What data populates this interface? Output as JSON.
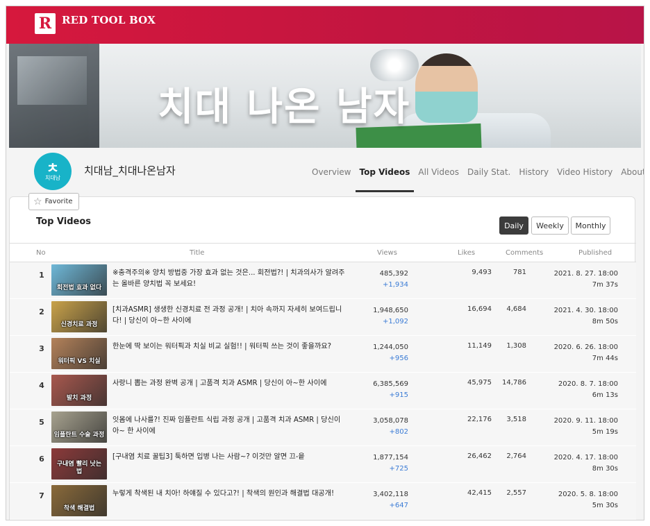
{
  "app": {
    "brand": "RED TOOL BOX",
    "logo_letter": "R"
  },
  "banner": {
    "title": "치대 나온 남자"
  },
  "channel": {
    "name": "치대남_치대나온남자",
    "avatar_glyph": "ㅊ",
    "avatar_sub": "치대남",
    "favorite_label": "Favorite"
  },
  "tabs": [
    {
      "label": "Overview"
    },
    {
      "label": "Top Videos"
    },
    {
      "label": "All Videos"
    },
    {
      "label": "Daily Stat."
    },
    {
      "label": "History"
    },
    {
      "label": "Video History"
    },
    {
      "label": "About"
    }
  ],
  "active_tab": "Top Videos",
  "section": {
    "title": "Top Videos",
    "periods": [
      {
        "label": "Daily"
      },
      {
        "label": "Weekly"
      },
      {
        "label": "Monthly"
      }
    ],
    "active_period": "Daily"
  },
  "table": {
    "headers": {
      "no": "No",
      "title": "Title",
      "views": "Views",
      "likes": "Likes",
      "comments": "Comments",
      "published": "Published"
    },
    "rows": [
      {
        "no": "1",
        "thumb_text": "회전법 효과 없다",
        "thumb_color": "#6fb8d8",
        "title": "※충격주의※ 양치 방법중 가장 효과 없는 것은... 회전법?! | 치과의사가 알려주는 올바른 양치법 꼭 보세요!",
        "views": "485,392",
        "delta": "+1,934",
        "likes": "9,493",
        "comments": "781",
        "date": "2021. 8. 27. 18:00",
        "duration": "7m 37s"
      },
      {
        "no": "2",
        "thumb_text": "신경치료 과정",
        "thumb_color": "#c9a24a",
        "title": "[치과ASMR] 생생한 신경치료 전 과정 공개! | 치아 속까지 자세히 보여드립니다! | 당신이 아~한 사이에",
        "views": "1,948,650",
        "delta": "+1,092",
        "likes": "16,694",
        "comments": "4,684",
        "date": "2021. 4. 30. 18:00",
        "duration": "8m 50s"
      },
      {
        "no": "3",
        "thumb_text": "워터픽 VS 치실",
        "thumb_color": "#b4825a",
        "title": "한눈에 딱 보이는 워터픽과 치실 비교 실험!! | 워터픽 쓰는 것이 좋을까요?",
        "views": "1,244,050",
        "delta": "+956",
        "likes": "11,149",
        "comments": "1,308",
        "date": "2020. 6. 26. 18:00",
        "duration": "7m 44s"
      },
      {
        "no": "4",
        "thumb_text": "발치 과정",
        "thumb_color": "#a8584e",
        "title": "사랑니 뽑는 과정 완벽 공개 | 고품격 치과 ASMR | 당신이 아~한 사이에",
        "views": "6,385,569",
        "delta": "+915",
        "likes": "45,975",
        "comments": "14,786",
        "date": "2020. 8. 7. 18:00",
        "duration": "6m 13s"
      },
      {
        "no": "5",
        "thumb_text": "임플란트 수술 과정",
        "thumb_color": "#a7a28f",
        "title": "잇몸에 나사를?! 진짜 임플란트 식립 과정 공개 | 고품격 치과 ASMR | 당신이 아~ 한 사이에",
        "views": "3,058,078",
        "delta": "+802",
        "likes": "22,176",
        "comments": "3,518",
        "date": "2020. 9. 11. 18:00",
        "duration": "5m 19s"
      },
      {
        "no": "6",
        "thumb_text": "구내염 빨리 낫는 법",
        "thumb_color": "#8c3a3a",
        "title": "[구내염 치료 꿀팁3] 툭하면 입병 나는 사람~? 이것만 알면 끄-읕",
        "views": "1,877,154",
        "delta": "+725",
        "likes": "26,462",
        "comments": "2,764",
        "date": "2020. 4. 17. 18:00",
        "duration": "8m 30s"
      },
      {
        "no": "7",
        "thumb_text": "착색 해결법",
        "thumb_color": "#8a6a3a",
        "title": "누렇게 착색된 내 치아! 하얘질 수 있다고?! | 착색의 원인과 해결법 대공개!",
        "views": "3,402,118",
        "delta": "+647",
        "likes": "42,415",
        "comments": "2,557",
        "date": "2020. 5. 8. 18:00",
        "duration": "5m 30s"
      }
    ]
  }
}
